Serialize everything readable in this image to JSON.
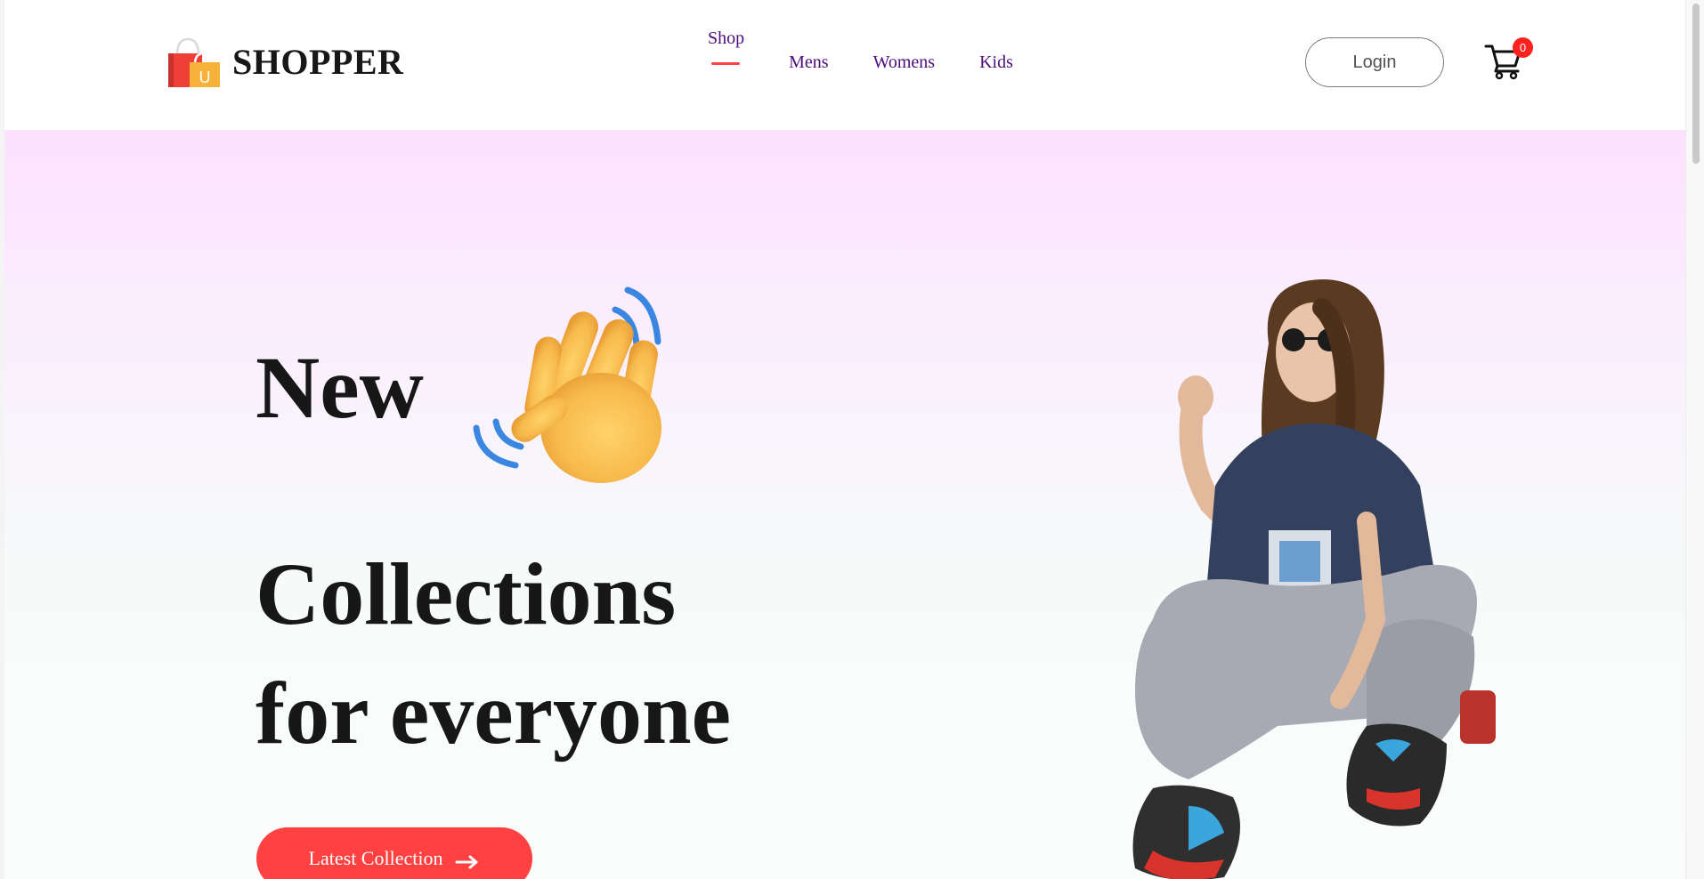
{
  "navbar": {
    "logo_text": "SHOPPER",
    "logo_icon": "shopping-bag-icon",
    "menu": [
      {
        "label": "Shop",
        "active": true
      },
      {
        "label": "Mens",
        "active": false
      },
      {
        "label": "Womens",
        "active": false
      },
      {
        "label": "Kids",
        "active": false
      }
    ],
    "login_label": "Login",
    "cart_icon": "cart-icon",
    "cart_count": "0"
  },
  "hero": {
    "line1": "New",
    "line2": "Collections",
    "line3": "for everyone",
    "wave_icon": "waving-hand-icon",
    "cta_label": "Latest Collection",
    "cta_icon": "arrow-right-icon",
    "image": "hero-model-image"
  },
  "colors": {
    "accent": "#ff4141",
    "nav_text": "#4b0d7a",
    "hero_gradient_top": "#fde1ff",
    "hero_gradient_bottom": "#fbfdfc"
  }
}
